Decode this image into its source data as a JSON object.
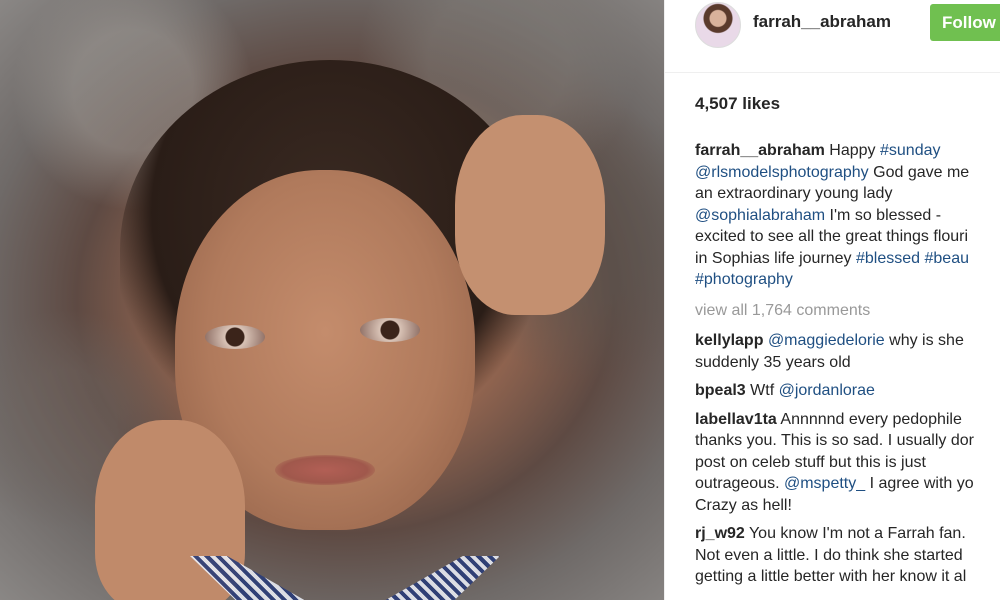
{
  "post": {
    "username": "farrah__abraham",
    "follow_label": "Follow",
    "likes": "4,507 likes",
    "caption": {
      "user": "farrah__abraham",
      "t1": "Happy",
      "tag_sunday": "#sunday",
      "mention_rls": "@rlsmodelsphotography",
      "t2": "God gave me",
      "t3": "an extraordinary young lady",
      "mention_sophia": "@sophialabraham",
      "t4": "I'm so blessed -",
      "t5": "excited to see all the great things flouri",
      "t6": "in Sophias life journey",
      "tag_blessed": "#blessed",
      "tag_beau": "#beau",
      "tag_photography": "#photography"
    },
    "view_all_comments": "view all 1,764 comments",
    "comments": {
      "c1": {
        "user": "kellylapp",
        "mention": "@maggiedelorie",
        "text1": "why is she",
        "text2": "suddenly 35 years old"
      },
      "c2": {
        "user": "bpeal3",
        "text1": "Wtf",
        "mention": "@jordanlorae"
      },
      "c3": {
        "user": "labellav1ta",
        "text1": "Annnnnd every pedophile",
        "text2": "thanks you. This is so sad. I usually dor",
        "text3": "post on celeb stuff but this is just",
        "text4": "outrageous.",
        "mention": "@mspetty_",
        "text5": "I agree with yo",
        "text6": "Crazy as hell!"
      },
      "c4": {
        "user": "rj_w92",
        "text1": "You know I'm not a Farrah fan.",
        "text2": "Not even a little. I do think she started",
        "text3": "getting a little better with her know it al"
      }
    }
  },
  "colors": {
    "follow_button": "#70c050",
    "link": "#1f4f82",
    "muted": "#999999",
    "text": "#262626"
  }
}
